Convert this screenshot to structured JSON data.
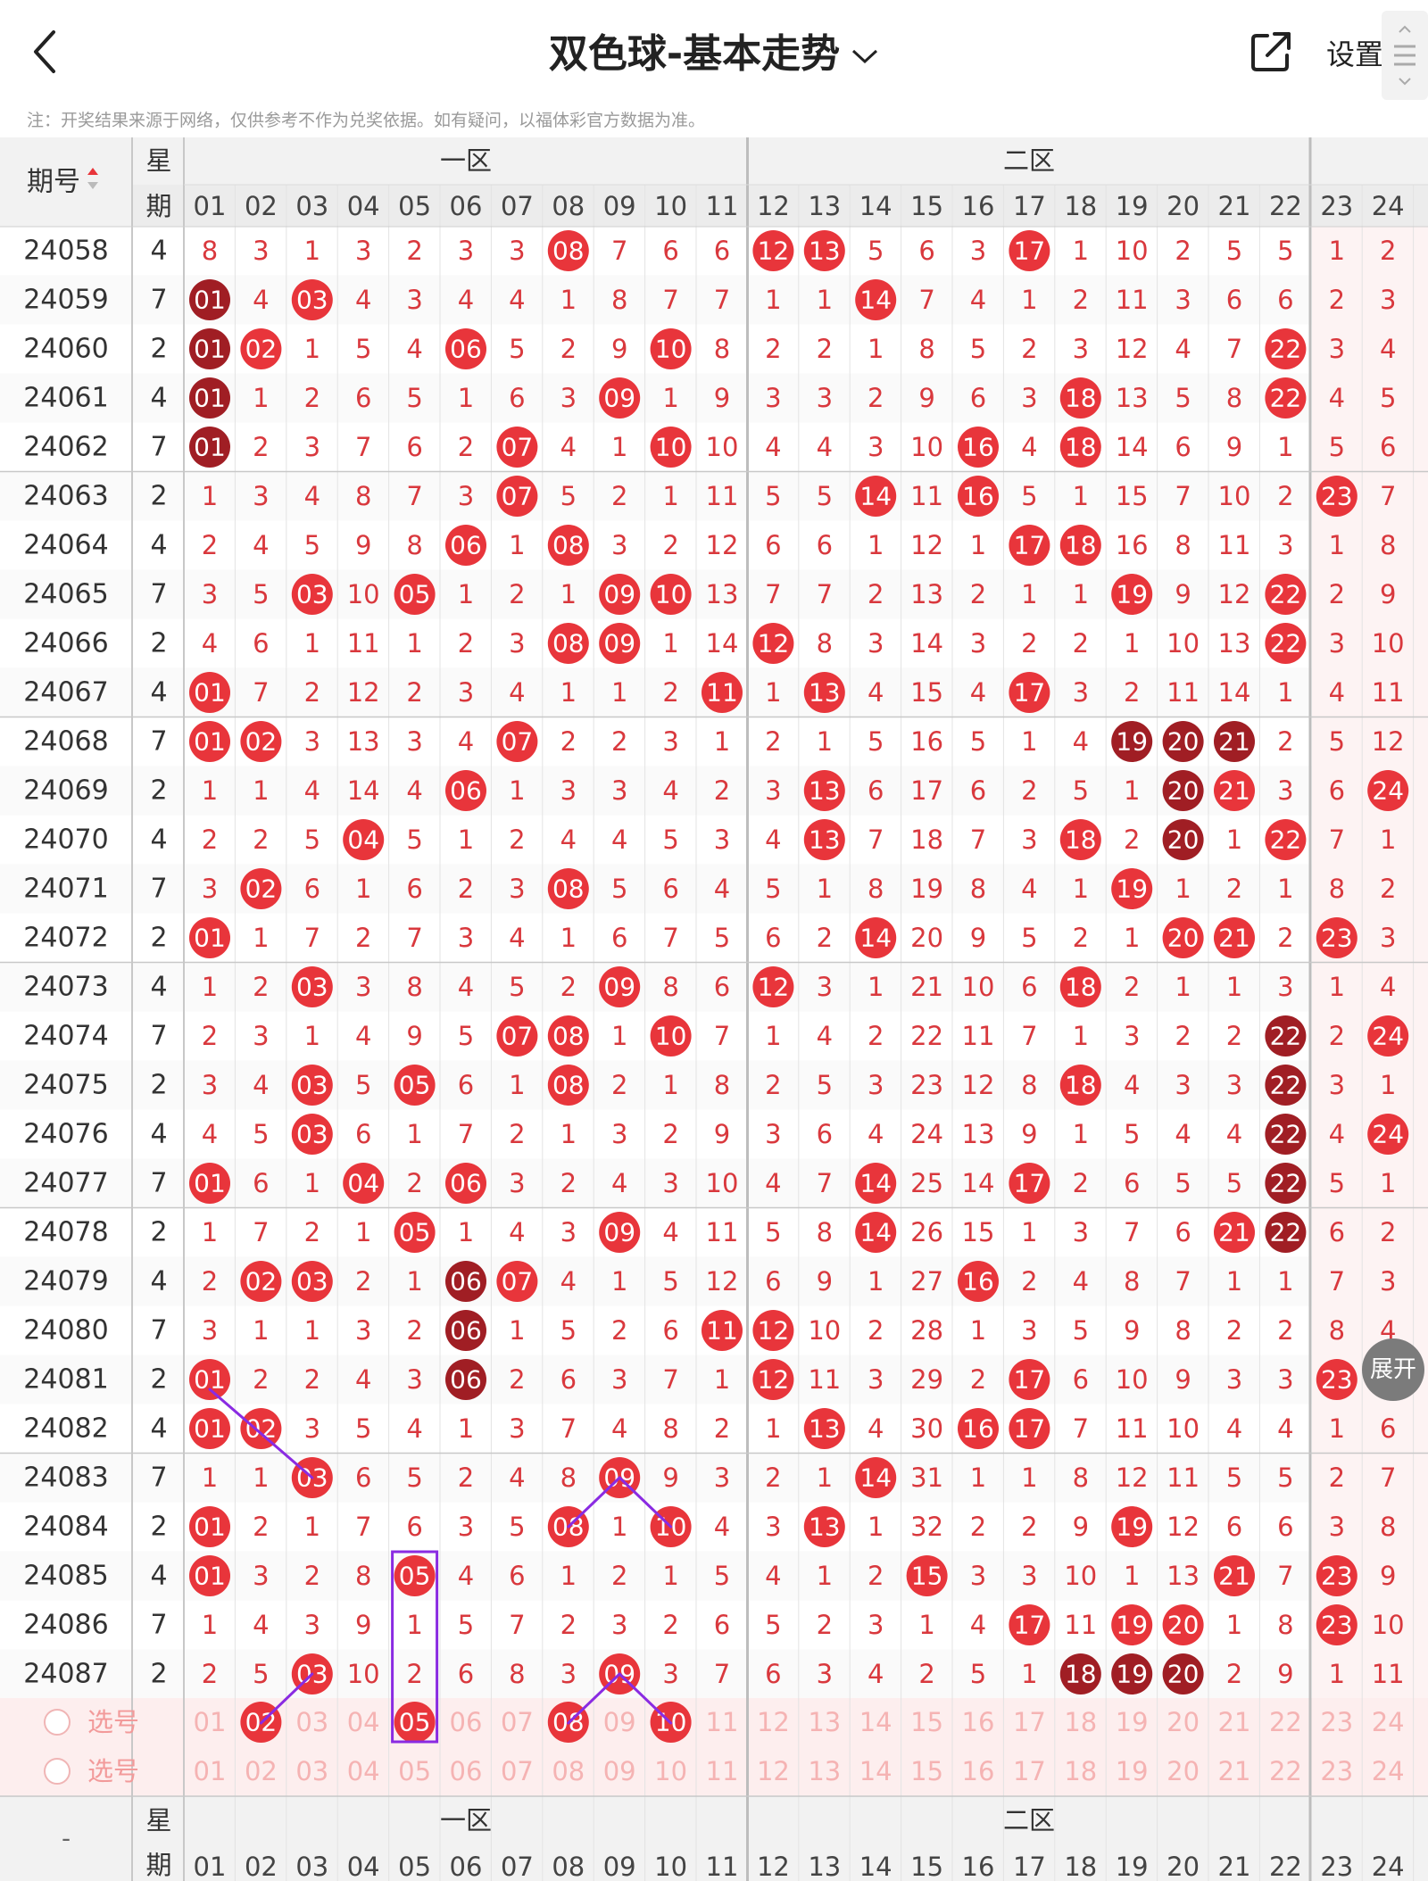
{
  "header": {
    "title": "双色球-基本走势",
    "settings_label": "设置",
    "note": "注：开奖结果来源于网络，仅供参考不作为兑奖依据。如有疑问，以福体彩官方数据为准。"
  },
  "columns": {
    "issue_header": "期号",
    "weekday_header": [
      "星",
      "期"
    ],
    "zone1_label": "一区",
    "zone2_label": "二区",
    "numbers": [
      "01",
      "02",
      "03",
      "04",
      "05",
      "06",
      "07",
      "08",
      "09",
      "10",
      "11",
      "12",
      "13",
      "14",
      "15",
      "16",
      "17",
      "18",
      "19",
      "20",
      "21",
      "22",
      "23",
      "24"
    ]
  },
  "rows": [
    {
      "issue": "24058",
      "day": "4",
      "cells": [
        "8",
        "3",
        "1",
        "3",
        "2",
        "3",
        "3",
        "08",
        "7",
        "6",
        "6",
        "12",
        "13",
        "5",
        "6",
        "3",
        "17",
        "1",
        "10",
        "2",
        "5",
        "5",
        "1",
        "2"
      ],
      "hits": [
        8,
        12,
        13,
        17
      ],
      "dark": []
    },
    {
      "issue": "24059",
      "day": "7",
      "cells": [
        "01",
        "4",
        "03",
        "4",
        "3",
        "4",
        "4",
        "1",
        "8",
        "7",
        "7",
        "1",
        "1",
        "14",
        "7",
        "4",
        "1",
        "2",
        "11",
        "3",
        "6",
        "6",
        "2",
        "3"
      ],
      "hits": [
        1,
        3,
        14
      ],
      "dark": [
        1
      ]
    },
    {
      "issue": "24060",
      "day": "2",
      "cells": [
        "01",
        "02",
        "1",
        "5",
        "4",
        "06",
        "5",
        "2",
        "9",
        "10",
        "8",
        "2",
        "2",
        "1",
        "8",
        "5",
        "2",
        "3",
        "12",
        "4",
        "7",
        "22",
        "3",
        "4"
      ],
      "hits": [
        1,
        2,
        6,
        10,
        22
      ],
      "dark": [
        1
      ]
    },
    {
      "issue": "24061",
      "day": "4",
      "cells": [
        "01",
        "1",
        "2",
        "6",
        "5",
        "1",
        "6",
        "3",
        "09",
        "1",
        "9",
        "3",
        "3",
        "2",
        "9",
        "6",
        "3",
        "18",
        "13",
        "5",
        "8",
        "22",
        "4",
        "5"
      ],
      "hits": [
        1,
        9,
        18,
        22
      ],
      "dark": [
        1
      ]
    },
    {
      "issue": "24062",
      "day": "7",
      "cells": [
        "01",
        "2",
        "3",
        "7",
        "6",
        "2",
        "07",
        "4",
        "1",
        "10",
        "10",
        "4",
        "4",
        "3",
        "10",
        "16",
        "4",
        "18",
        "14",
        "6",
        "9",
        "1",
        "5",
        "6"
      ],
      "hits": [
        1,
        7,
        10,
        16,
        18
      ],
      "dark": [
        1
      ]
    },
    {
      "issue": "24063",
      "day": "2",
      "cells": [
        "1",
        "3",
        "4",
        "8",
        "7",
        "3",
        "07",
        "5",
        "2",
        "1",
        "11",
        "5",
        "5",
        "14",
        "11",
        "16",
        "5",
        "1",
        "15",
        "7",
        "10",
        "2",
        "23",
        "7"
      ],
      "hits": [
        7,
        14,
        16,
        23
      ],
      "dark": []
    },
    {
      "issue": "24064",
      "day": "4",
      "cells": [
        "2",
        "4",
        "5",
        "9",
        "8",
        "06",
        "1",
        "08",
        "3",
        "2",
        "12",
        "6",
        "6",
        "1",
        "12",
        "1",
        "17",
        "18",
        "16",
        "8",
        "11",
        "3",
        "1",
        "8"
      ],
      "hits": [
        6,
        8,
        17,
        18
      ],
      "dark": []
    },
    {
      "issue": "24065",
      "day": "7",
      "cells": [
        "3",
        "5",
        "03",
        "10",
        "05",
        "1",
        "2",
        "1",
        "09",
        "10",
        "13",
        "7",
        "7",
        "2",
        "13",
        "2",
        "1",
        "1",
        "19",
        "9",
        "12",
        "22",
        "2",
        "9"
      ],
      "hits": [
        3,
        5,
        9,
        10,
        19,
        22
      ],
      "dark": []
    },
    {
      "issue": "24066",
      "day": "2",
      "cells": [
        "4",
        "6",
        "1",
        "11",
        "1",
        "2",
        "3",
        "08",
        "09",
        "1",
        "14",
        "12",
        "8",
        "3",
        "14",
        "3",
        "2",
        "2",
        "1",
        "10",
        "13",
        "22",
        "3",
        "10"
      ],
      "hits": [
        8,
        9,
        12,
        22
      ],
      "dark": []
    },
    {
      "issue": "24067",
      "day": "4",
      "cells": [
        "01",
        "7",
        "2",
        "12",
        "2",
        "3",
        "4",
        "1",
        "1",
        "2",
        "11",
        "1",
        "13",
        "4",
        "15",
        "4",
        "17",
        "3",
        "2",
        "11",
        "14",
        "1",
        "4",
        "11"
      ],
      "hits": [
        1,
        11,
        13,
        17
      ],
      "dark": []
    },
    {
      "issue": "24068",
      "day": "7",
      "cells": [
        "01",
        "02",
        "3",
        "13",
        "3",
        "4",
        "07",
        "2",
        "2",
        "3",
        "1",
        "2",
        "1",
        "5",
        "16",
        "5",
        "1",
        "4",
        "19",
        "20",
        "21",
        "2",
        "5",
        "12"
      ],
      "hits": [
        1,
        2,
        7,
        19,
        20,
        21
      ],
      "dark": [
        19,
        20,
        21
      ]
    },
    {
      "issue": "24069",
      "day": "2",
      "cells": [
        "1",
        "1",
        "4",
        "14",
        "4",
        "06",
        "1",
        "3",
        "3",
        "4",
        "2",
        "3",
        "13",
        "6",
        "17",
        "6",
        "2",
        "5",
        "1",
        "20",
        "21",
        "3",
        "6",
        "24"
      ],
      "hits": [
        6,
        13,
        20,
        21,
        24
      ],
      "dark": [
        20
      ]
    },
    {
      "issue": "24070",
      "day": "4",
      "cells": [
        "2",
        "2",
        "5",
        "04",
        "5",
        "1",
        "2",
        "4",
        "4",
        "5",
        "3",
        "4",
        "13",
        "7",
        "18",
        "7",
        "3",
        "18",
        "2",
        "20",
        "1",
        "22",
        "7",
        "1"
      ],
      "hits": [
        4,
        13,
        18,
        20,
        22
      ],
      "dark": [
        20
      ]
    },
    {
      "issue": "24071",
      "day": "7",
      "cells": [
        "3",
        "02",
        "6",
        "1",
        "6",
        "2",
        "3",
        "08",
        "5",
        "6",
        "4",
        "5",
        "1",
        "8",
        "19",
        "8",
        "4",
        "1",
        "19",
        "1",
        "2",
        "1",
        "8",
        "2"
      ],
      "hits": [
        2,
        8,
        19
      ],
      "dark": []
    },
    {
      "issue": "24072",
      "day": "2",
      "cells": [
        "01",
        "1",
        "7",
        "2",
        "7",
        "3",
        "4",
        "1",
        "6",
        "7",
        "5",
        "6",
        "2",
        "14",
        "20",
        "9",
        "5",
        "2",
        "1",
        "20",
        "21",
        "2",
        "23",
        "3"
      ],
      "hits": [
        1,
        14,
        20,
        21,
        23
      ],
      "dark": []
    },
    {
      "issue": "24073",
      "day": "4",
      "cells": [
        "1",
        "2",
        "03",
        "3",
        "8",
        "4",
        "5",
        "2",
        "09",
        "8",
        "6",
        "12",
        "3",
        "1",
        "21",
        "10",
        "6",
        "18",
        "2",
        "1",
        "1",
        "3",
        "1",
        "4"
      ],
      "hits": [
        3,
        9,
        12,
        18
      ],
      "dark": []
    },
    {
      "issue": "24074",
      "day": "7",
      "cells": [
        "2",
        "3",
        "1",
        "4",
        "9",
        "5",
        "07",
        "08",
        "1",
        "10",
        "7",
        "1",
        "4",
        "2",
        "22",
        "11",
        "7",
        "1",
        "3",
        "2",
        "2",
        "22",
        "2",
        "24"
      ],
      "hits": [
        7,
        8,
        10,
        22,
        24
      ],
      "dark": [
        22
      ]
    },
    {
      "issue": "24075",
      "day": "2",
      "cells": [
        "3",
        "4",
        "03",
        "5",
        "05",
        "6",
        "1",
        "08",
        "2",
        "1",
        "8",
        "2",
        "5",
        "3",
        "23",
        "12",
        "8",
        "18",
        "4",
        "3",
        "3",
        "22",
        "3",
        "1"
      ],
      "hits": [
        3,
        5,
        8,
        18,
        22
      ],
      "dark": [
        22
      ]
    },
    {
      "issue": "24076",
      "day": "4",
      "cells": [
        "4",
        "5",
        "03",
        "6",
        "1",
        "7",
        "2",
        "1",
        "3",
        "2",
        "9",
        "3",
        "6",
        "4",
        "24",
        "13",
        "9",
        "1",
        "5",
        "4",
        "4",
        "22",
        "4",
        "24"
      ],
      "hits": [
        3,
        22,
        24
      ],
      "dark": [
        22
      ]
    },
    {
      "issue": "24077",
      "day": "7",
      "cells": [
        "01",
        "6",
        "1",
        "04",
        "2",
        "06",
        "3",
        "2",
        "4",
        "3",
        "10",
        "4",
        "7",
        "14",
        "25",
        "14",
        "17",
        "2",
        "6",
        "5",
        "5",
        "22",
        "5",
        "1"
      ],
      "hits": [
        1,
        4,
        6,
        14,
        17,
        22
      ],
      "dark": [
        22
      ]
    },
    {
      "issue": "24078",
      "day": "2",
      "cells": [
        "1",
        "7",
        "2",
        "1",
        "05",
        "1",
        "4",
        "3",
        "09",
        "4",
        "11",
        "5",
        "8",
        "14",
        "26",
        "15",
        "1",
        "3",
        "7",
        "6",
        "21",
        "22",
        "6",
        "2"
      ],
      "hits": [
        5,
        9,
        14,
        21,
        22
      ],
      "dark": [
        22
      ]
    },
    {
      "issue": "24079",
      "day": "4",
      "cells": [
        "2",
        "02",
        "03",
        "2",
        "1",
        "06",
        "07",
        "4",
        "1",
        "5",
        "12",
        "6",
        "9",
        "1",
        "27",
        "16",
        "2",
        "4",
        "8",
        "7",
        "1",
        "1",
        "7",
        "3"
      ],
      "hits": [
        2,
        3,
        6,
        7,
        16
      ],
      "dark": [
        6
      ]
    },
    {
      "issue": "24080",
      "day": "7",
      "cells": [
        "3",
        "1",
        "1",
        "3",
        "2",
        "06",
        "1",
        "5",
        "2",
        "6",
        "11",
        "12",
        "10",
        "2",
        "28",
        "1",
        "3",
        "5",
        "9",
        "8",
        "2",
        "2",
        "8",
        "4"
      ],
      "hits": [
        6,
        11,
        12
      ],
      "dark": [
        6
      ]
    },
    {
      "issue": "24081",
      "day": "2",
      "cells": [
        "01",
        "2",
        "2",
        "4",
        "3",
        "06",
        "2",
        "6",
        "3",
        "7",
        "1",
        "12",
        "11",
        "3",
        "29",
        "2",
        "17",
        "6",
        "10",
        "9",
        "3",
        "3",
        "23",
        "5"
      ],
      "hits": [
        1,
        6,
        12,
        17,
        23
      ],
      "dark": [
        6
      ]
    },
    {
      "issue": "24082",
      "day": "4",
      "cells": [
        "01",
        "02",
        "3",
        "5",
        "4",
        "1",
        "3",
        "7",
        "4",
        "8",
        "2",
        "1",
        "13",
        "4",
        "30",
        "16",
        "17",
        "7",
        "11",
        "10",
        "4",
        "4",
        "1",
        "6"
      ],
      "hits": [
        1,
        2,
        13,
        16,
        17
      ],
      "dark": []
    },
    {
      "issue": "24083",
      "day": "7",
      "cells": [
        "1",
        "1",
        "03",
        "6",
        "5",
        "2",
        "4",
        "8",
        "09",
        "9",
        "3",
        "2",
        "1",
        "14",
        "31",
        "1",
        "1",
        "8",
        "12",
        "11",
        "5",
        "5",
        "2",
        "7"
      ],
      "hits": [
        3,
        9,
        14
      ],
      "dark": []
    },
    {
      "issue": "24084",
      "day": "2",
      "cells": [
        "01",
        "2",
        "1",
        "7",
        "6",
        "3",
        "5",
        "08",
        "1",
        "10",
        "4",
        "3",
        "13",
        "1",
        "32",
        "2",
        "2",
        "9",
        "19",
        "12",
        "6",
        "6",
        "3",
        "8"
      ],
      "hits": [
        1,
        8,
        10,
        13,
        19
      ],
      "dark": []
    },
    {
      "issue": "24085",
      "day": "4",
      "cells": [
        "01",
        "3",
        "2",
        "8",
        "05",
        "4",
        "6",
        "1",
        "2",
        "1",
        "5",
        "4",
        "1",
        "2",
        "15",
        "3",
        "3",
        "10",
        "1",
        "13",
        "21",
        "7",
        "23",
        "9"
      ],
      "hits": [
        1,
        5,
        15,
        21,
        23
      ],
      "dark": []
    },
    {
      "issue": "24086",
      "day": "7",
      "cells": [
        "1",
        "4",
        "3",
        "9",
        "1",
        "5",
        "7",
        "2",
        "3",
        "2",
        "6",
        "5",
        "2",
        "3",
        "1",
        "4",
        "17",
        "11",
        "19",
        "20",
        "1",
        "8",
        "23",
        "10"
      ],
      "hits": [
        17,
        19,
        20,
        23
      ],
      "dark": []
    },
    {
      "issue": "24087",
      "day": "2",
      "cells": [
        "2",
        "5",
        "03",
        "10",
        "2",
        "6",
        "8",
        "3",
        "09",
        "3",
        "7",
        "6",
        "3",
        "4",
        "2",
        "5",
        "1",
        "18",
        "19",
        "20",
        "2",
        "9",
        "1",
        "11"
      ],
      "hits": [
        3,
        9,
        18,
        19,
        20
      ],
      "dark": [
        18,
        19,
        20
      ]
    }
  ],
  "select_rows": [
    {
      "label": "选号",
      "hits": [
        2,
        5,
        8,
        10
      ]
    },
    {
      "label": "选号",
      "hits": []
    }
  ],
  "footer": {
    "issue_placeholder": "-"
  },
  "expand_label": "展开",
  "colors": {
    "hit": "#e8353b",
    "hit_dark": "#a01e24",
    "cell_text": "#d9383d",
    "issue_text": "#333333",
    "grid_line": "#dcdcdc",
    "annotation": "#8a2be2"
  }
}
